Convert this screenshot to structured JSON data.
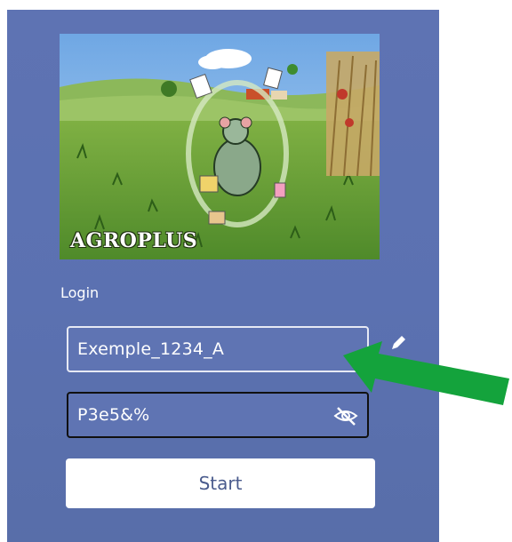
{
  "brand": {
    "name": "AGROPLUS"
  },
  "form": {
    "login_label": "Login",
    "login_value": "Exemple_1234_A",
    "password_value": "P3e5&%",
    "start_label": "Start"
  },
  "colors": {
    "panel": "#5b71b1",
    "field_bg": "#5f74b3",
    "button_text": "#4a5b8d",
    "arrow": "#14a33c"
  },
  "icons": {
    "password_toggle": "eye-slash-icon",
    "edit": "pencil-icon",
    "annotation": "green-arrow"
  }
}
